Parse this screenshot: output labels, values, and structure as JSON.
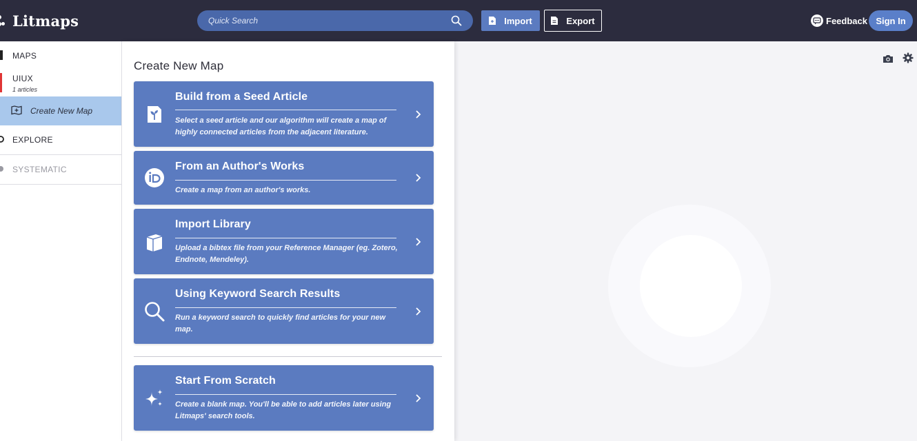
{
  "header": {
    "app_name": "Litmaps",
    "search_placeholder": "Quick Search",
    "import_label": "Import",
    "export_label": "Export",
    "feedback_label": "Feedback",
    "signin_label": "Sign In"
  },
  "sidebar": {
    "maps_label": "MAPS",
    "map_item": {
      "name": "UIUX",
      "count": "1 articles"
    },
    "create_new_map_label": "Create New Map",
    "explore_label": "EXPLORE",
    "systematic_label": "SYSTEMATIC"
  },
  "panel": {
    "title": "Create New Map",
    "cards": [
      {
        "title": "Build from a Seed Article",
        "description": "Select a seed article and our algorithm will create a map of highly connected articles from the adjacent literature.",
        "icon": "seed-article-icon"
      },
      {
        "title": "From an Author's Works",
        "description": "Create a map from an author's works.",
        "icon": "orcid-icon"
      },
      {
        "title": "Import Library",
        "description": "Upload a bibtex file from your Reference Manager (eg. Zotero, Endnote, Mendeley).",
        "icon": "book-icon"
      },
      {
        "title": "Using Keyword Search Results",
        "description": "Run a keyword search to quickly find articles for your new map.",
        "icon": "search-icon"
      },
      {
        "title": "Start From Scratch",
        "description": "Create a blank map. You'll be able to add articles later using Litmaps' search tools.",
        "icon": "sparkles-icon"
      }
    ]
  },
  "colors": {
    "header_bg": "#2c2c3e",
    "card_bg": "#5b7bc0",
    "search_bg": "#4a68aa",
    "selected_row": "#a9c8ec",
    "map_item_accent": "#e03535"
  }
}
